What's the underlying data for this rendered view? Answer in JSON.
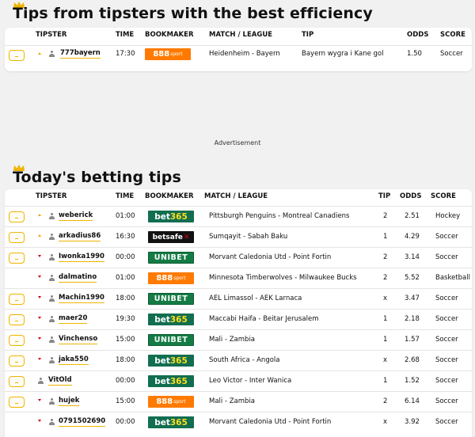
{
  "section1": {
    "title": "Tips from tipsters with the best efficiency",
    "headers": {
      "tipster": "TIPSTER",
      "time": "TIME",
      "bookmaker": "BOOKMAKER",
      "match": "MATCH / LEAGUE",
      "tip": "TIP",
      "odds": "ODDS",
      "score": "SCORE"
    },
    "rows": [
      {
        "tipster": "777bayern",
        "trend": "up",
        "time": "17:30",
        "bookmaker": "888sport",
        "match": "Heidenheim - Bayern",
        "tip": "Bayern wygra i Kane gol",
        "odds": "1.50",
        "score": "Soccer"
      }
    ]
  },
  "advertisement": "Advertisement",
  "section2": {
    "title": "Today's betting tips",
    "headers": {
      "tipster": "TIPSTER",
      "time": "TIME",
      "bookmaker": "BOOKMAKER",
      "match": "MATCH / LEAGUE",
      "tip": "TIP",
      "odds": "ODDS",
      "score": "SCORE"
    },
    "rows": [
      {
        "tipster": "weberick",
        "trend": "up",
        "star": true,
        "time": "01:00",
        "bookmaker": "bet365",
        "match": "Pittsburgh Penguins - Montreal Canadiens",
        "tip": "2",
        "odds": "2.51",
        "score": "Hockey"
      },
      {
        "tipster": "arkadius86",
        "trend": "up",
        "star": true,
        "time": "16:30",
        "bookmaker": "betsafe",
        "match": "Sumqayit - Sabah Baku",
        "tip": "1",
        "odds": "4.29",
        "score": "Soccer"
      },
      {
        "tipster": "Iwonka1990",
        "trend": "down",
        "star": true,
        "time": "00:00",
        "bookmaker": "unibet",
        "match": "Morvant Caledonia Utd - Point Fortin",
        "tip": "2",
        "odds": "3.14",
        "score": "Soccer"
      },
      {
        "tipster": "dalmatino",
        "trend": "down",
        "star": false,
        "time": "01:00",
        "bookmaker": "888sport",
        "match": "Minnesota Timberwolves - Milwaukee Bucks",
        "tip": "2",
        "odds": "5.52",
        "score": "Basketball"
      },
      {
        "tipster": "Machin1990",
        "trend": "down",
        "star": true,
        "time": "18:00",
        "bookmaker": "unibet",
        "match": "AEL Limassol - AEK Larnaca",
        "tip": "x",
        "odds": "3.47",
        "score": "Soccer"
      },
      {
        "tipster": "maer20",
        "trend": "down",
        "star": true,
        "time": "19:30",
        "bookmaker": "bet365",
        "match": "Maccabi Haifa - Beitar Jerusalem",
        "tip": "1",
        "odds": "2.18",
        "score": "Soccer"
      },
      {
        "tipster": "Vinchenso",
        "trend": "down",
        "star": true,
        "time": "15:00",
        "bookmaker": "unibet",
        "match": "Mali - Zambia",
        "tip": "1",
        "odds": "1.57",
        "score": "Soccer"
      },
      {
        "tipster": "jaka550",
        "trend": "down",
        "star": true,
        "time": "18:00",
        "bookmaker": "bet365",
        "match": "South Africa - Angola",
        "tip": "x",
        "odds": "2.68",
        "score": "Soccer"
      },
      {
        "tipster": "VitOld",
        "trend": "none",
        "star": true,
        "time": "00:00",
        "bookmaker": "bet365",
        "match": "Leo Victor - Inter Wanica",
        "tip": "1",
        "odds": "1.52",
        "score": "Soccer"
      },
      {
        "tipster": "hujek",
        "trend": "down",
        "star": true,
        "time": "15:00",
        "bookmaker": "888sport",
        "match": "Mali - Zambia",
        "tip": "2",
        "odds": "6.14",
        "score": "Soccer"
      },
      {
        "tipster": "0791502690",
        "trend": "down",
        "star": false,
        "time": "00:00",
        "bookmaker": "bet365",
        "match": "Morvant Caledonia Utd - Point Fortin",
        "tip": "x",
        "odds": "3.92",
        "score": "Soccer"
      }
    ]
  },
  "bookmaker_logos": {
    "888sport": {
      "main": "888",
      "sub": "sport"
    },
    "bet365": {
      "main": "bet",
      "accent": "365"
    },
    "unibet": {
      "main": "UNIBET"
    },
    "betsafe": {
      "main": "betsafe",
      "accent": "✕"
    }
  },
  "colors": {
    "accent": "#f0b400",
    "up": "#f0a500",
    "down": "#d0021b",
    "bet365": "#126e51",
    "unibet": "#147b45",
    "888": "#ff7a00",
    "betsafe": "#111111"
  }
}
